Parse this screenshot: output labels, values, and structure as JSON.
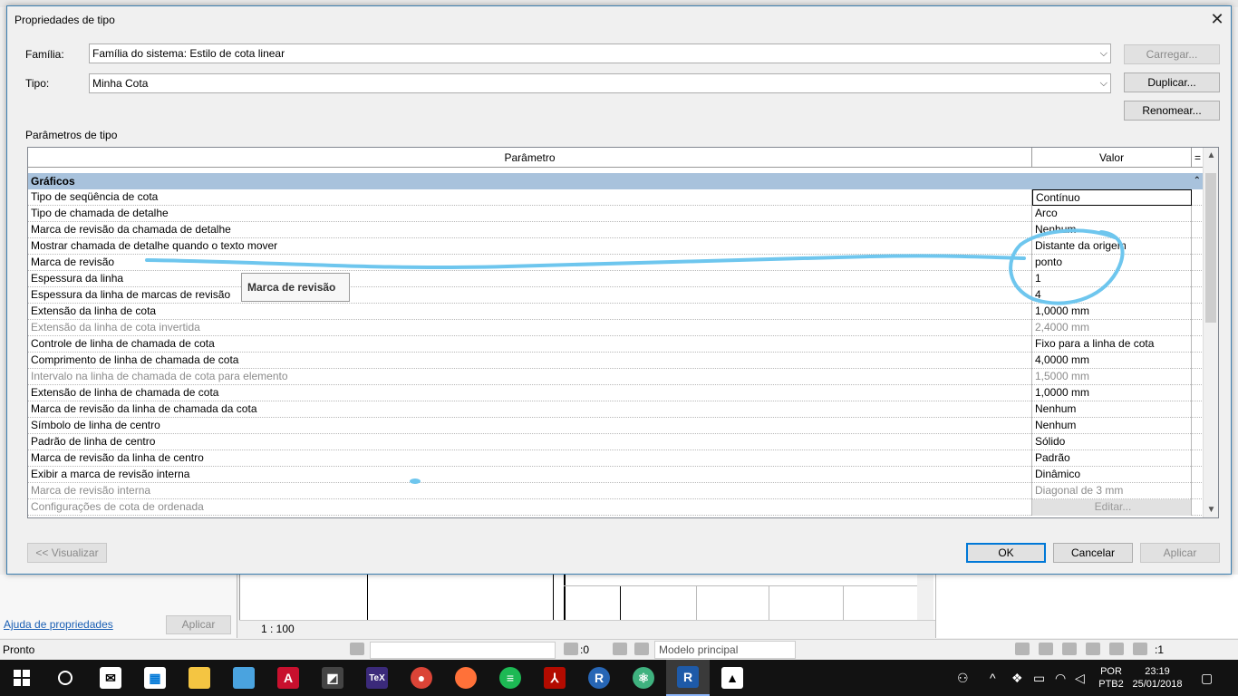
{
  "dialog": {
    "title": "Propriedades de tipo",
    "family_label": "Família:",
    "family_value": "Família do sistema: Estilo de cota linear",
    "type_label": "Tipo:",
    "type_value": "Minha Cota",
    "load_button": "Carregar...",
    "duplicate_button": "Duplicar...",
    "rename_button": "Renomear...",
    "params_label": "Parâmetros de tipo",
    "preview_button": "<< Visualizar",
    "ok_button": "OK",
    "cancel_button": "Cancelar",
    "apply_button": "Aplicar"
  },
  "grid": {
    "col_param": "Parâmetro",
    "col_value": "Valor",
    "col_eq": "=",
    "group": "Gráficos",
    "rows": [
      {
        "param": "Tipo de seqüência de cota",
        "value": "Contínuo"
      },
      {
        "param": "Tipo de chamada de detalhe",
        "value": "Arco"
      },
      {
        "param": "Marca de revisão da chamada de detalhe",
        "value": "Nenhum"
      },
      {
        "param": "Mostrar chamada de detalhe quando o texto mover",
        "value": "Distante da origem"
      },
      {
        "param": "Marca de revisão",
        "value": "ponto"
      },
      {
        "param": "Espessura da linha",
        "value": "1"
      },
      {
        "param": "Espessura da linha de marcas de revisão",
        "value": "4"
      },
      {
        "param": "Extensão da linha de cota",
        "value": "1,0000 mm"
      },
      {
        "param": "Extensão da linha de cota invertida",
        "value": "2,4000 mm"
      },
      {
        "param": "Controle de linha de chamada de cota",
        "value": "Fixo para a linha de cota"
      },
      {
        "param": "Comprimento de linha de chamada de cota",
        "value": "4,0000 mm"
      },
      {
        "param": "Intervalo na linha de chamada de cota para elemento",
        "value": "1,5000 mm"
      },
      {
        "param": "Extensão de linha de chamada de cota",
        "value": "1,0000 mm"
      },
      {
        "param": "Marca de revisão da linha de chamada da cota",
        "value": "Nenhum"
      },
      {
        "param": "Símbolo de linha de centro",
        "value": "Nenhum"
      },
      {
        "param": "Padrão de linha de centro",
        "value": "Sólido"
      },
      {
        "param": "Marca de revisão da linha de centro",
        "value": "Padrão"
      },
      {
        "param": "Exibir a marca de revisão interna",
        "value": "Dinâmico"
      },
      {
        "param": "Marca de revisão interna",
        "value": "Diagonal de 3 mm"
      },
      {
        "param": "Configurações de cota de ordenada",
        "value": "Editar..."
      }
    ]
  },
  "tooltip": "Marca de revisão",
  "background": {
    "help_link": "Ajuda de propriedades",
    "apply": "Aplicar",
    "scale": "1 : 100",
    "status": "Pronto",
    "zero": ":0",
    "model": "Modelo principal",
    "filter": ":1"
  },
  "taskbar": {
    "lang1": "POR",
    "lang2": "PTB2",
    "time": "23:19",
    "date": "25/01/2018"
  },
  "colors": {
    "group_header": "#a8c2dc",
    "annotation": "#6ec6ee",
    "taskbar": "#121212"
  }
}
